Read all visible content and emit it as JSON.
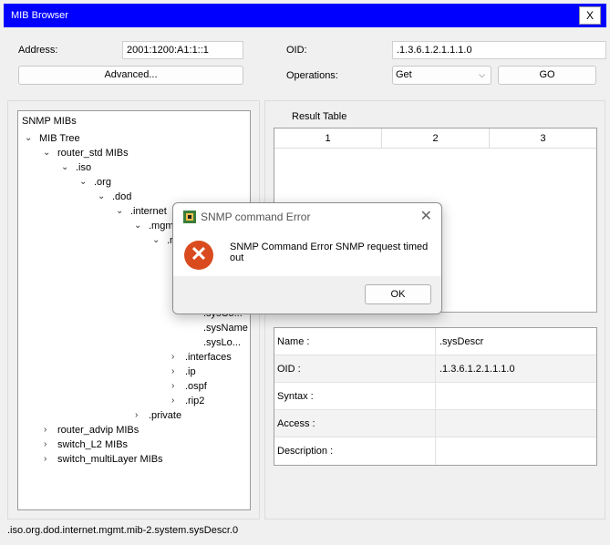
{
  "window": {
    "title": "MIB Browser",
    "close_label": "X"
  },
  "top": {
    "address_label": "Address:",
    "address_value": "2001:1200:A1:1::1",
    "advanced_label": "Advanced...",
    "oid_label": "OID:",
    "oid_value": ".1.3.6.1.2.1.1.1.0",
    "operations_label": "Operations:",
    "operations_value": "Get",
    "go_label": "GO"
  },
  "tree": {
    "root_label": "SNMP MIBs",
    "nodes": [
      {
        "label": "MIB Tree",
        "state": "expanded"
      },
      {
        "label": "router_std MIBs",
        "state": "expanded"
      },
      {
        "label": ".iso",
        "state": "expanded"
      },
      {
        "label": ".org",
        "state": "expanded"
      },
      {
        "label": ".dod",
        "state": "expanded"
      },
      {
        "label": ".internet",
        "state": "expanded"
      },
      {
        "label": ".mgmt",
        "state": "expanded"
      },
      {
        "label": ".r",
        "state": "expanded"
      },
      {
        "label": ".sysCo...",
        "state": "leaf"
      },
      {
        "label": ".sysName",
        "state": "leaf"
      },
      {
        "label": ".sysLo...",
        "state": "leaf"
      },
      {
        "label": ".interfaces",
        "state": "collapsed"
      },
      {
        "label": ".ip",
        "state": "collapsed"
      },
      {
        "label": ".ospf",
        "state": "collapsed"
      },
      {
        "label": ".rip2",
        "state": "collapsed"
      },
      {
        "label": ".private",
        "state": "collapsed"
      },
      {
        "label": "router_advip MIBs",
        "state": "collapsed"
      },
      {
        "label": "switch_L2 MIBs",
        "state": "collapsed"
      },
      {
        "label": "switch_multiLayer MIBs",
        "state": "collapsed"
      }
    ]
  },
  "result": {
    "title": "Result Table",
    "columns": [
      "1",
      "2",
      "3"
    ]
  },
  "info": [
    {
      "key": "Name :",
      "value": ".sysDescr"
    },
    {
      "key": "OID :",
      "value": ".1.3.6.1.2.1.1.1.0"
    },
    {
      "key": "Syntax :",
      "value": ""
    },
    {
      "key": "Access :",
      "value": ""
    },
    {
      "key": "Description :",
      "value": ""
    }
  ],
  "status_path": ".iso.org.dod.internet.mgmt.mib-2.system.sysDescr.0",
  "dialog": {
    "title": "SNMP command Error",
    "message": "SNMP Command Error SNMP request timed out",
    "ok_label": "OK",
    "close_glyph": "✕",
    "error_glyph": "✕"
  },
  "colors": {
    "titlebar": "#0000ff",
    "error": "#d94b1f"
  }
}
